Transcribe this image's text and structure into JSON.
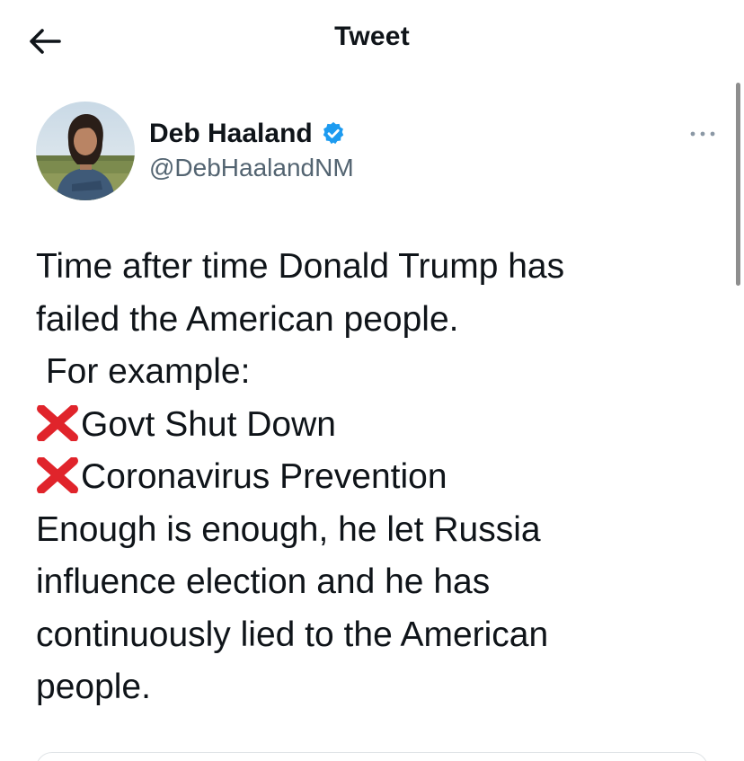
{
  "header": {
    "title": "Tweet",
    "back_icon": "arrow-left-icon"
  },
  "author": {
    "display_name": "Deb Haaland",
    "handle": "@DebHaalandNM",
    "verified": true,
    "verified_color": "#1d9bf0",
    "avatar_icon": "profile-photo"
  },
  "more_icon": "more-horizontal-icon",
  "tweet": {
    "lines": [
      "Time after time Donald Trump has",
      "failed the American people.",
      " For example:",
      "Govt Shut Down",
      "Coronavirus Prevention",
      "Enough is enough, he let Russia",
      "influence election and he has",
      "continuously lied to the American",
      "people."
    ],
    "bullet_icon": "cross-mark-emoji",
    "bullet_color": "#e0242b"
  },
  "colors": {
    "text": "#0f1419",
    "secondary_text": "#536471",
    "accent": "#1d9bf0"
  }
}
